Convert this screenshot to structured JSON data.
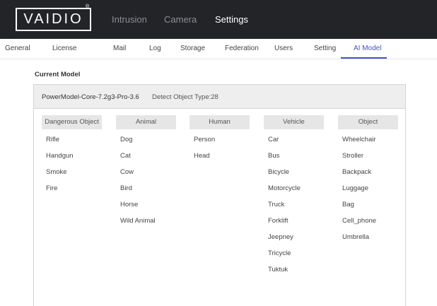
{
  "brand": {
    "logo_text": "VAIDIO",
    "reg_mark": "®"
  },
  "top_nav": [
    "Intrusion",
    "Camera",
    "Settings"
  ],
  "sub_nav": [
    "General",
    "License",
    "Mail",
    "Log",
    "Storage",
    "Federation",
    "Users",
    "Setting",
    "AI Model"
  ],
  "active_sub_nav": "AI Model",
  "accent_color": "#3e55c8",
  "current_model": {
    "section_label": "Current Model",
    "name": "PowerModel-Core-7.2g3-Pro-3.6",
    "detect_type": "Detect Object Type:28"
  },
  "categories": [
    {
      "title": "Dangerous Object",
      "items": [
        "Rifle",
        "Handgun",
        "Smoke",
        "Fire"
      ]
    },
    {
      "title": "Animal",
      "items": [
        "Dog",
        "Cat",
        "Cow",
        "Bird",
        "Horse",
        "Wild Animal"
      ]
    },
    {
      "title": "Human",
      "items": [
        "Person",
        "Head"
      ]
    },
    {
      "title": "Vehicle",
      "items": [
        "Car",
        "Bus",
        "Bicycle",
        "Motorcycle",
        "Truck",
        "Forklift",
        "Jeepney",
        "Tricycle",
        "Tuktuk"
      ]
    },
    {
      "title": "Object",
      "items": [
        "Wheelchair",
        "Stroller",
        "Backpack",
        "Luggage",
        "Bag",
        "Cell_phone",
        "Umbrella"
      ]
    }
  ]
}
